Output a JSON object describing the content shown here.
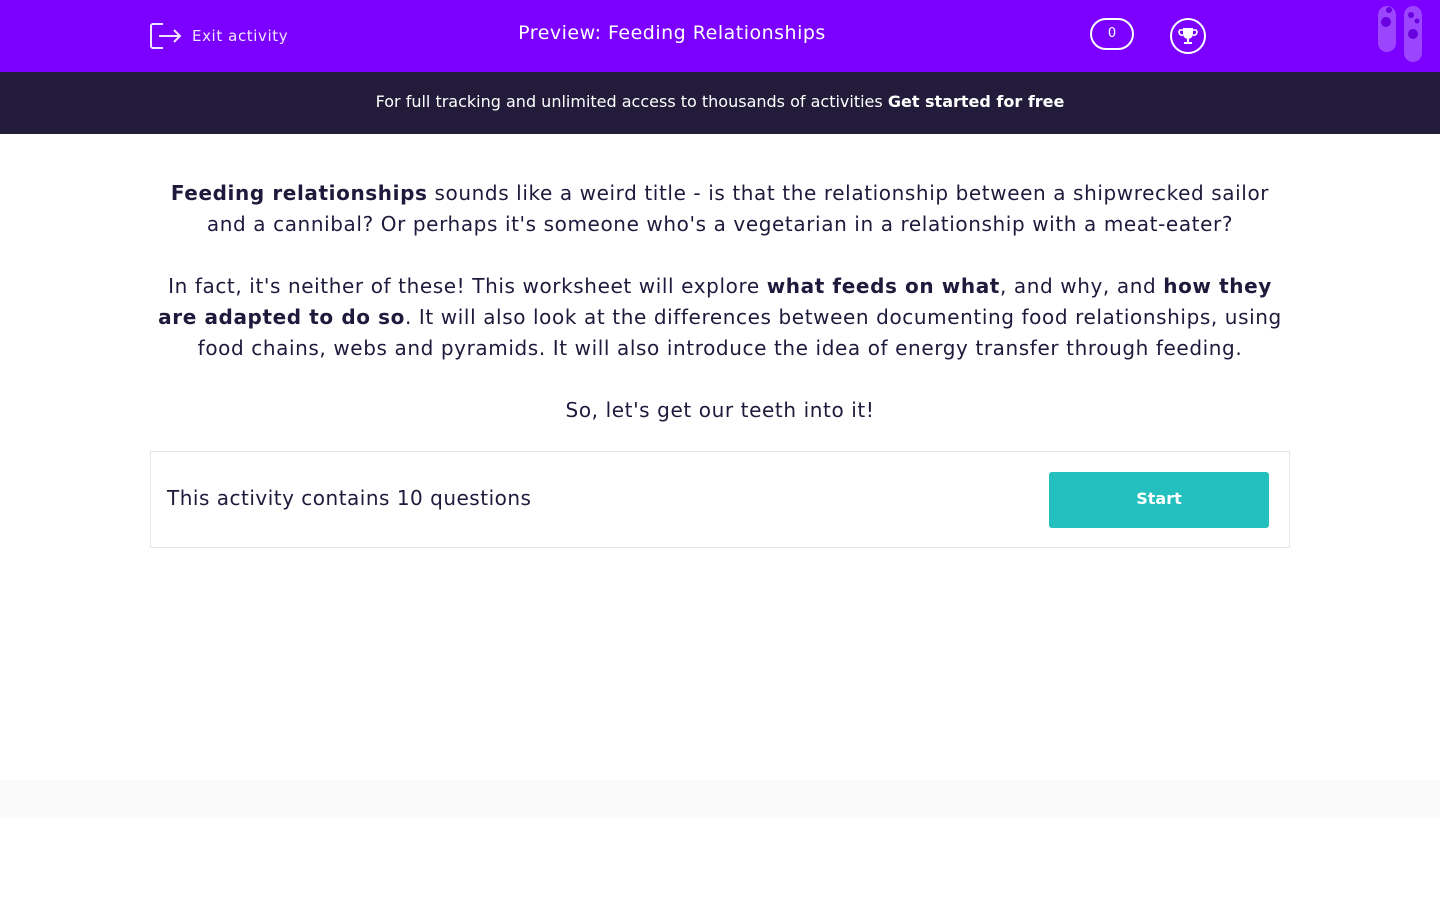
{
  "header": {
    "exit_label": "Exit activity",
    "title": "Preview: Feeding Relationships",
    "score": "0",
    "colors": {
      "bar": "#7b00ff",
      "banner": "#221c3a",
      "accent": "#24bfbf"
    }
  },
  "banner": {
    "text": "For full tracking and unlimited access to thousands of activities ",
    "cta": "Get started for free"
  },
  "intro": {
    "p1": {
      "bold": "Feeding relationships",
      "rest": " sounds like a weird title - is that the relationship between a shipwrecked sailor and a cannibal? Or perhaps it's someone who's a vegetarian in a relationship with a meat-eater?"
    },
    "p2": {
      "a": "In fact, it's neither of these! This worksheet will explore ",
      "b1": "what feeds on what",
      "c": ", and why, and ",
      "b2": "how they are adapted to do so",
      "d": ". It will also look at the differences between documenting food relationships, using food chains, webs and pyramids. It will also introduce the idea of energy transfer through feeding."
    },
    "p3": "So, let's get our teeth into it!"
  },
  "activity": {
    "summary": "This activity contains 10 questions",
    "start_label": "Start"
  },
  "icons": {
    "exit": "exit-door-icon",
    "trophy": "trophy-icon",
    "tubes": "test-tubes-icon"
  }
}
